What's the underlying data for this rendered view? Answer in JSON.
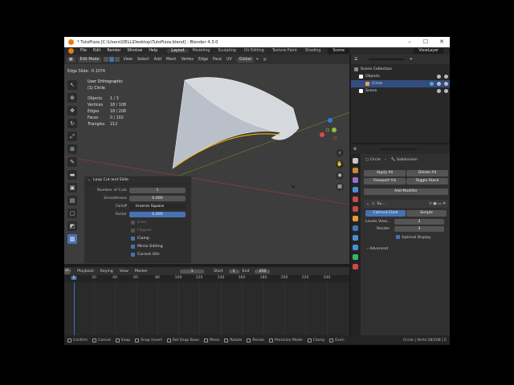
{
  "window": {
    "title": "* TutoPizza [C:\\Users\\DELL\\Desktop\\TutoPizza.blend] - Blender 4.3.0",
    "buttons": [
      "–",
      "☐",
      "✕"
    ]
  },
  "menubar": {
    "menus": [
      "File",
      "Edit",
      "Render",
      "Window",
      "Help"
    ],
    "workspaces": [
      "Layout",
      "Modeling",
      "Sculpting",
      "UV Editing",
      "Texture Paint",
      "Shading"
    ],
    "active_workspace": "Layout",
    "scene": "Scene",
    "view_layer": "ViewLayer"
  },
  "viewport_header": {
    "mode": "Edit Mode",
    "menus": [
      "View",
      "Select",
      "Add",
      "Mesh",
      "Vertex",
      "Edge",
      "Face",
      "UV"
    ],
    "orientation": "Global"
  },
  "viewport": {
    "status": "Edge Slide: -0.1074",
    "view_name": "User Orthographic",
    "object_name": "(1) Circle",
    "stats": [
      {
        "label": "Objects",
        "value": "1 / 3"
      },
      {
        "label": "Vertices",
        "value": "18 / 108"
      },
      {
        "label": "Edges",
        "value": "18 / 208"
      },
      {
        "label": "Faces",
        "value": "0 / 102"
      },
      {
        "label": "Triangles",
        "value": "212"
      }
    ]
  },
  "operator_panel": {
    "title": "Loop Cut and Slide",
    "fields": [
      {
        "label": "Number of Cuts",
        "value": "1"
      },
      {
        "label": "Smoothness",
        "value": "0.000"
      },
      {
        "label": "Falloff",
        "value": "Inverse Square"
      },
      {
        "label": "Factor",
        "value": "0.000"
      }
    ],
    "checks": [
      {
        "label": "Even",
        "checked": false,
        "enabled": false
      },
      {
        "label": "Flipped",
        "checked": false,
        "enabled": false
      },
      {
        "label": "Clamp",
        "checked": true,
        "enabled": true
      },
      {
        "label": "Mirror Editing",
        "checked": true,
        "enabled": true
      },
      {
        "label": "Correct UVs",
        "checked": true,
        "enabled": true
      }
    ]
  },
  "timeline": {
    "menus": [
      "Playback",
      "Keying",
      "View",
      "Marker"
    ],
    "current_frame": "1",
    "start_label": "Start",
    "start": "1",
    "end_label": "End",
    "end": "250",
    "ruler": [
      "1",
      "20",
      "40",
      "60",
      "80",
      "100",
      "120",
      "140",
      "160",
      "180",
      "200",
      "220",
      "240"
    ]
  },
  "statusbar": {
    "items": [
      "Confirm",
      "Cancel",
      "Snap",
      "Snap Invert",
      "Set Snap Base",
      "Move",
      "Rotate",
      "Resize",
      "Precision Mode",
      "Clamp",
      "Even"
    ],
    "info": "Circle | Verts:18/108 | E"
  },
  "outliner": {
    "search_placeholder": "",
    "rows": [
      {
        "label": "Scene Collection",
        "selected": false,
        "indent": 0
      },
      {
        "label": "Objects",
        "selected": false,
        "indent": 1
      },
      {
        "label": "Circle",
        "selected": true,
        "indent": 2
      },
      {
        "label": "Scene",
        "selected": false,
        "indent": 1
      }
    ]
  },
  "properties": {
    "search_placeholder": "",
    "breadcrumb_object": "Circle",
    "breadcrumb_modifier": "Subdivision",
    "buttons": {
      "apply_all": "Apply All",
      "delete_all": "Delete All",
      "viewport_vis": "Viewport Vis",
      "toggle_stack": "Toggle Stack",
      "add_modifier": "Add Modifier"
    },
    "modifier": {
      "name": "Su...",
      "type_catmull": "Catmull-Clark",
      "type_simple": "Simple",
      "levels_viewport_label": "Levels View...",
      "levels_viewport": "3",
      "render_label": "Render",
      "render": "3",
      "optimal_display": "Optimal Display",
      "advanced": "Advanced"
    }
  },
  "colors": {
    "accent": "#4772b3",
    "blender_orange": "#e87d0d",
    "viewport_bg": "#3d3d3d"
  }
}
